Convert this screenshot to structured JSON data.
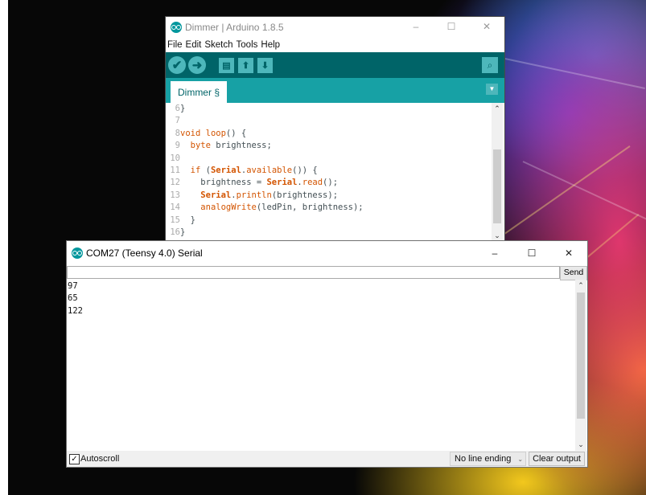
{
  "ide": {
    "title": "Dimmer | Arduino 1.8.5",
    "window_controls": {
      "minimize": "–",
      "maximize": "☐",
      "close": "✕"
    },
    "menu": [
      "File",
      "Edit",
      "Sketch",
      "Tools",
      "Help"
    ],
    "toolbar": {
      "verify_icon": "check-icon",
      "upload_icon": "arrow-right-icon",
      "new_icon": "new-file-icon",
      "open_icon": "arrow-up-icon",
      "save_icon": "arrow-down-icon",
      "serial_monitor_icon": "magnifier-icon"
    },
    "tab": {
      "label": "Dimmer §"
    },
    "code_lines": [
      {
        "n": "6",
        "text": "}"
      },
      {
        "n": "7",
        "text": ""
      },
      {
        "n": "8",
        "text": "void loop() {"
      },
      {
        "n": "9",
        "text": "  byte brightness;"
      },
      {
        "n": "10",
        "text": ""
      },
      {
        "n": "11",
        "text": "  if (Serial.available()) {"
      },
      {
        "n": "12",
        "text": "    brightness = Serial.read();"
      },
      {
        "n": "13",
        "text": "    Serial.println(brightness);"
      },
      {
        "n": "14",
        "text": "    analogWrite(ledPin, brightness);"
      },
      {
        "n": "15",
        "text": "  }"
      },
      {
        "n": "16",
        "text": "}"
      }
    ]
  },
  "serial": {
    "title": "COM27 (Teensy 4.0) Serial",
    "window_controls": {
      "minimize": "–",
      "maximize": "☐",
      "close": "✕"
    },
    "send_label": "Send",
    "input_value": "",
    "output_lines": [
      "97",
      "65",
      "122"
    ],
    "autoscroll_label": "Autoscroll",
    "autoscroll_checked": true,
    "line_ending": "No line ending",
    "clear_label": "Clear output"
  },
  "colors": {
    "arduino_teal_dark": "#006468",
    "arduino_teal": "#17a1a5",
    "arduino_button": "#4db7bb",
    "keyword_orange": "#d35400"
  }
}
